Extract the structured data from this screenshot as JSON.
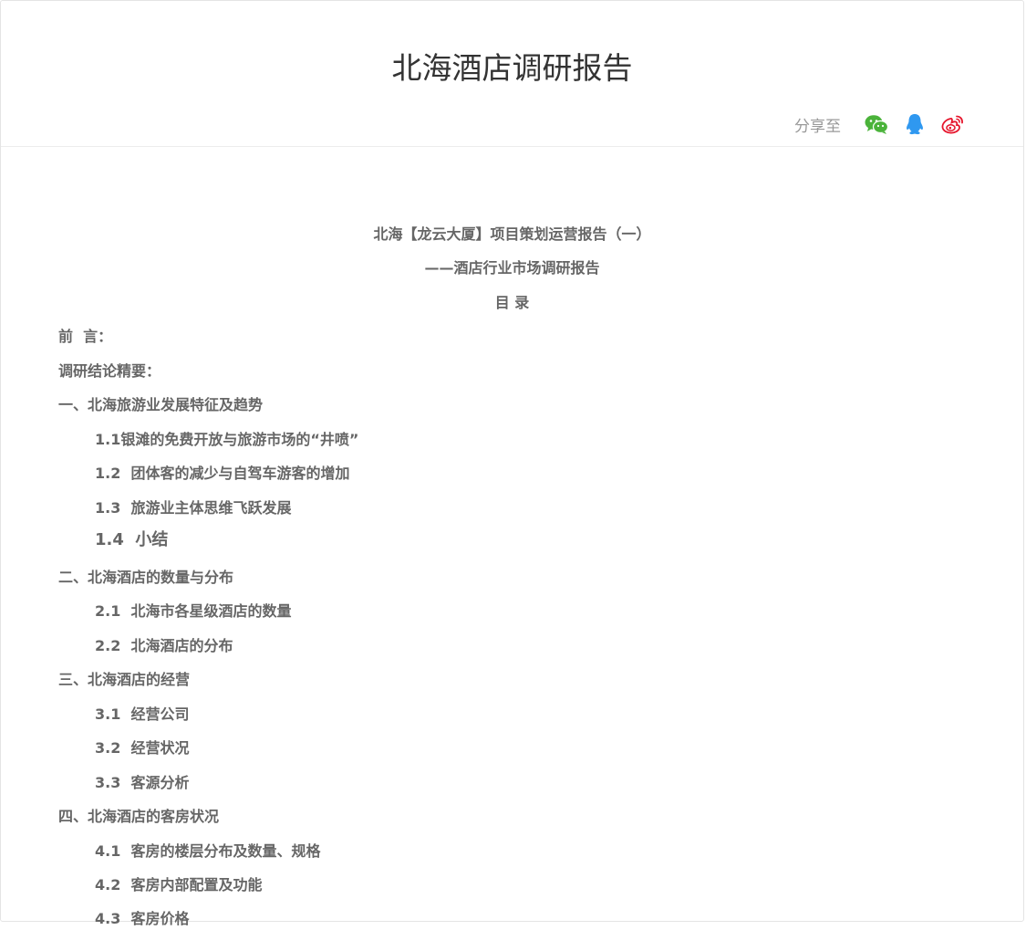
{
  "header": {
    "title": "北海酒店调研报告",
    "share_label": "分享至",
    "share_icons": [
      "wechat-icon",
      "qq-icon",
      "weibo-icon"
    ],
    "colors": {
      "wechat": "#4ab33a",
      "qq": "#2f98f0",
      "weibo": "#e6162d"
    }
  },
  "doc": {
    "heading1": "北海【龙云大厦】项目策划运营报告（一）",
    "heading2": "——酒店行业市场调研报告",
    "toc_title": "目  录",
    "lines": [
      "前  言：",
      "调研结论精要：",
      "一、北海旅游业发展特征及趋势",
      "1.1银滩的免费开放与旅游市场的“井喷”",
      "1.2  团体客的减少与自驾车游客的增加",
      "1.3  旅游业主体思维飞跃发展",
      "1.4  小结",
      "二、北海酒店的数量与分布",
      "2.1  北海市各星级酒店的数量",
      "2.2  北海酒店的分布",
      "三、北海酒店的经营",
      "3.1  经营公司",
      "3.2  经营状况",
      "3.3  客源分析",
      "四、北海酒店的客房状况",
      "4.1  客房的楼层分布及数量、规格",
      "4.2  客房内部配置及功能",
      "4.3  客房价格"
    ]
  }
}
